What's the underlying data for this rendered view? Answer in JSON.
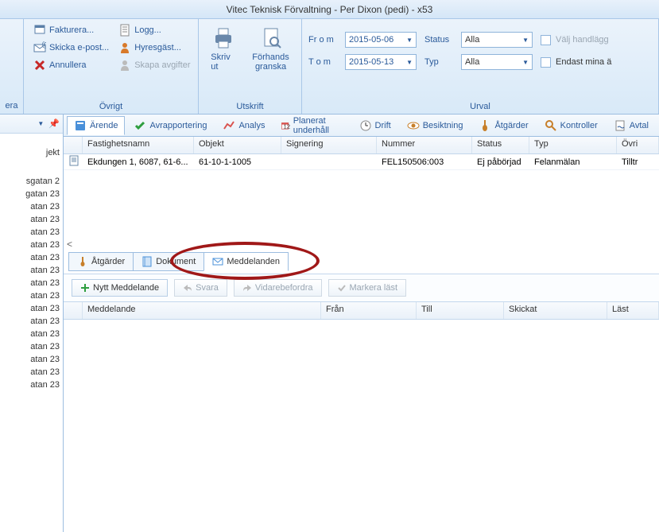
{
  "title": "Vitec Teknisk Förvaltning - Per Dixon (pedi) - x53",
  "ribbon": {
    "edge_label": "era",
    "ovrigt": {
      "title": "Övrigt",
      "fakturera": "Fakturera...",
      "epost": "Skicka e-post...",
      "annullera": "Annullera",
      "logg": "Logg...",
      "hyresgast": "Hyresgäst...",
      "skapa": "Skapa avgifter"
    },
    "utskrift": {
      "title": "Utskrift",
      "skriv": "Skriv ut",
      "forhands": "Förhands\ngranska"
    },
    "urval": {
      "title": "Urval",
      "from_label": "Fr o m",
      "tom_label": "T o m",
      "from_value": "2015-05-06",
      "tom_value": "2015-05-13",
      "status_label": "Status",
      "typ_label": "Typ",
      "status_value": "Alla",
      "typ_value": "Alla",
      "valj": "Välj handlägg",
      "endast": "Endast mina ä"
    }
  },
  "tool_tabs": {
    "arende": "Ärende",
    "avrapportering": "Avrapportering",
    "analys": "Analys",
    "planerat": "Planerat underhåll",
    "drift": "Drift",
    "besiktning": "Besiktning",
    "atgarder": "Åtgärder",
    "kontroller": "Kontroller",
    "avtal": "Avtal"
  },
  "grid": {
    "headers": {
      "fastighetsnamn": "Fastighetsnamn",
      "objekt": "Objekt",
      "signering": "Signering",
      "nummer": "Nummer",
      "status": "Status",
      "typ": "Typ",
      "ovrigt": "Övri"
    },
    "row": {
      "fastighetsnamn": "Ekdungen 1, 6087, 61-6...",
      "objekt": "61-10-1-1005",
      "signering": "",
      "nummer": "FEL150506:003",
      "status": "Ej påbörjad",
      "typ": "Felanmälan",
      "ovrigt": "Tilltr"
    }
  },
  "sub_tabs": {
    "atgarder": "Åtgärder",
    "dokument": "Dokument",
    "meddelanden": "Meddelanden"
  },
  "buttons": {
    "nytt": "Nytt Meddelande",
    "svara": "Svara",
    "vidare": "Vidarebefordra",
    "markera": "Markera läst"
  },
  "msg_headers": {
    "meddelande": "Meddelande",
    "fran": "Från",
    "till": "Till",
    "skickat": "Skickat",
    "last": "Läst"
  },
  "left": {
    "top": "jekt",
    "items": [
      "sgatan 2",
      "gatan 23",
      "atan 23",
      "atan 23",
      "atan 23",
      "atan 23",
      "atan 23",
      "atan 23",
      "atan 23",
      "atan 23",
      "atan 23",
      "atan 23",
      "atan 23",
      "atan 23",
      "atan 23",
      "atan 23",
      "atan 23"
    ]
  }
}
